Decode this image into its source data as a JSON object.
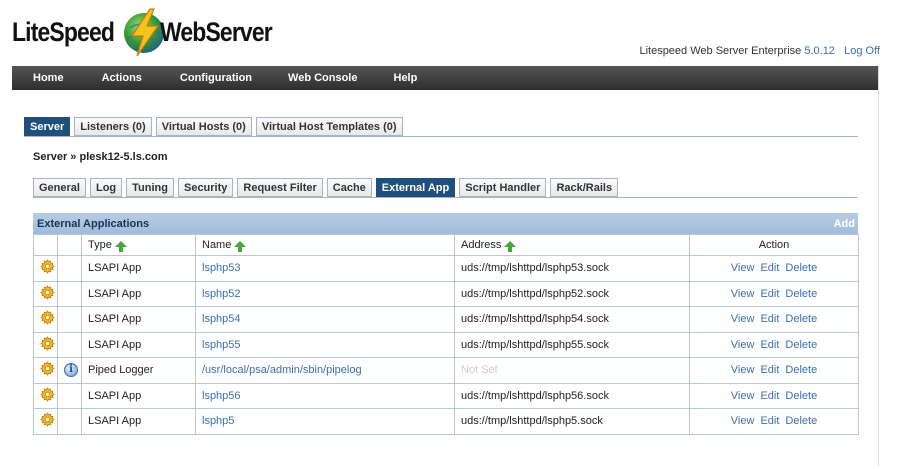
{
  "brand": {
    "logo_left": "LiteSpeed",
    "logo_right": "WebServer"
  },
  "header": {
    "product": "Litespeed Web Server Enterprise",
    "version": "5.0.12",
    "logoff": "Log Off"
  },
  "menu": [
    {
      "label": "Home"
    },
    {
      "label": "Actions"
    },
    {
      "label": "Configuration"
    },
    {
      "label": "Web Console"
    },
    {
      "label": "Help"
    }
  ],
  "main_tabs": [
    {
      "label": "Server",
      "active": true
    },
    {
      "label": "Listeners (0)"
    },
    {
      "label": "Virtual Hosts (0)"
    },
    {
      "label": "Virtual Host Templates (0)"
    }
  ],
  "breadcrumb": "Server » plesk12-5.ls.com",
  "sub_tabs": [
    {
      "label": "General"
    },
    {
      "label": "Log"
    },
    {
      "label": "Tuning"
    },
    {
      "label": "Security"
    },
    {
      "label": "Request Filter"
    },
    {
      "label": "Cache"
    },
    {
      "label": "External App",
      "active": true
    },
    {
      "label": "Script Handler"
    },
    {
      "label": "Rack/Rails"
    }
  ],
  "panel": {
    "title": "External Applications",
    "add": "Add",
    "columns": {
      "type": "Type",
      "name": "Name",
      "address": "Address",
      "action": "Action"
    },
    "actions": {
      "view": "View",
      "edit": "Edit",
      "delete": "Delete"
    },
    "rows": [
      {
        "type": "LSAPI App",
        "name": "lsphp53",
        "address": "uds://tmp/lshttpd/lsphp53.sock",
        "info": false
      },
      {
        "type": "LSAPI App",
        "name": "lsphp52",
        "address": "uds://tmp/lshttpd/lsphp52.sock",
        "info": false
      },
      {
        "type": "LSAPI App",
        "name": "lsphp54",
        "address": "uds://tmp/lshttpd/lsphp54.sock",
        "info": false
      },
      {
        "type": "LSAPI App",
        "name": "lsphp55",
        "address": "uds://tmp/lshttpd/lsphp55.sock",
        "info": false
      },
      {
        "type": "Piped Logger",
        "name": "/usr/local/psa/admin/sbin/pipelog",
        "address": "Not Set",
        "info": true,
        "notset": true
      },
      {
        "type": "LSAPI App",
        "name": "lsphp56",
        "address": "uds://tmp/lshttpd/lsphp56.sock",
        "info": false
      },
      {
        "type": "LSAPI App",
        "name": "lsphp5",
        "address": "uds://tmp/lshttpd/lsphp5.sock",
        "info": false
      }
    ]
  },
  "colors": {
    "menubar": "#3a3a3a",
    "tab_active": "#1f4f7d",
    "panel_head": "#a9c3df",
    "link": "#3b6fae",
    "sort_arrow": "#46a836",
    "gear": "#f0b42a"
  },
  "icons": {
    "logo": "lightning-globe-icon",
    "row": "gear-icon",
    "info": "info-icon",
    "sort": "sort-up-arrow-icon"
  }
}
